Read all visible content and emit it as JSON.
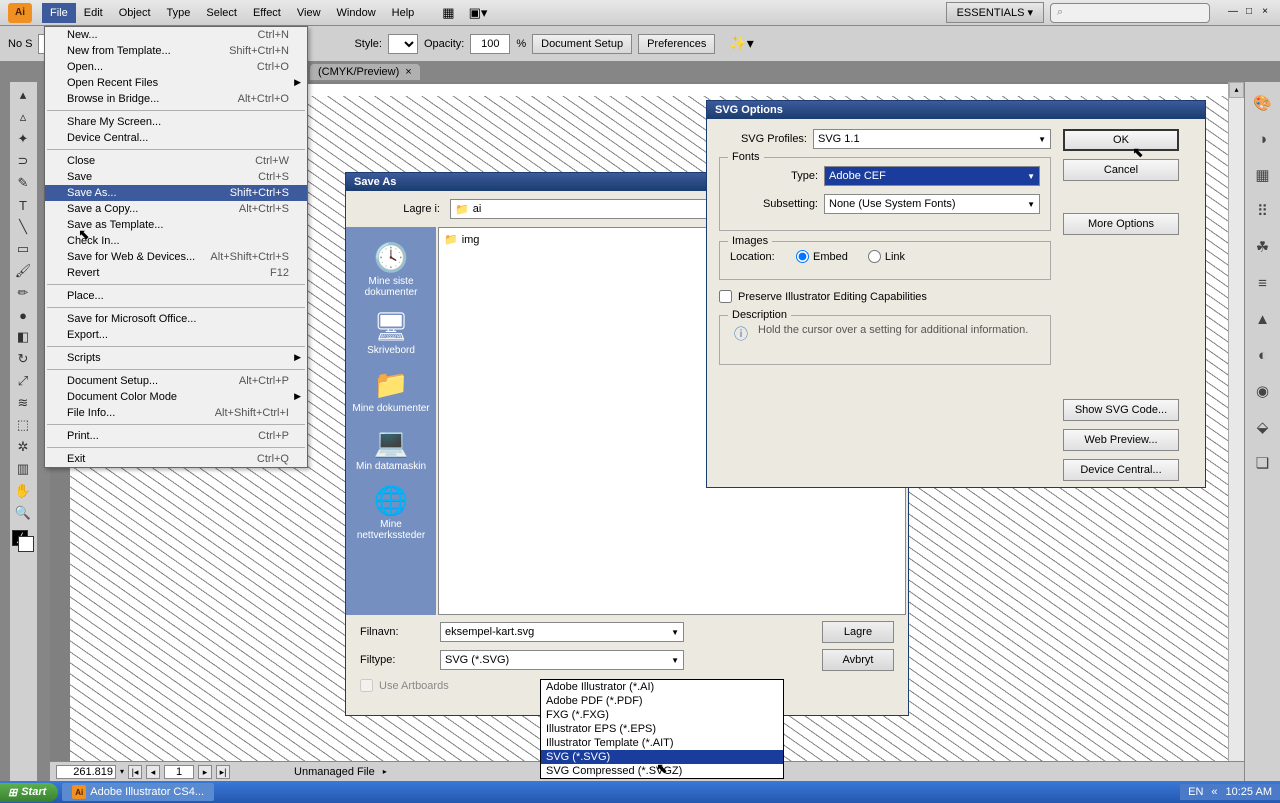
{
  "menubar": {
    "app_icon": "Ai",
    "items": [
      "File",
      "Edit",
      "Object",
      "Type",
      "Select",
      "Effect",
      "View",
      "Window",
      "Help"
    ],
    "essentials": "ESSENTIALS ▾"
  },
  "optbar": {
    "no_selection": "No S",
    "style": "Style:",
    "opacity_label": "Opacity:",
    "opacity_value": "100",
    "opacity_unit": "%",
    "doc_setup": "Document Setup",
    "preferences": "Preferences"
  },
  "doctab": {
    "label": "(CMYK/Preview)",
    "close": "×"
  },
  "file_menu": [
    {
      "label": "New...",
      "shortcut": "Ctrl+N"
    },
    {
      "label": "New from Template...",
      "shortcut": "Shift+Ctrl+N"
    },
    {
      "label": "Open...",
      "shortcut": "Ctrl+O"
    },
    {
      "label": "Open Recent Files",
      "submenu": true
    },
    {
      "label": "Browse in Bridge...",
      "shortcut": "Alt+Ctrl+O"
    },
    {
      "sep": true
    },
    {
      "label": "Share My Screen..."
    },
    {
      "label": "Device Central..."
    },
    {
      "sep": true
    },
    {
      "label": "Close",
      "shortcut": "Ctrl+W"
    },
    {
      "label": "Save",
      "shortcut": "Ctrl+S"
    },
    {
      "label": "Save As...",
      "shortcut": "Shift+Ctrl+S",
      "selected": true
    },
    {
      "label": "Save a Copy...",
      "shortcut": "Alt+Ctrl+S"
    },
    {
      "label": "Save as Template..."
    },
    {
      "label": "Check In..."
    },
    {
      "label": "Save for Web & Devices...",
      "shortcut": "Alt+Shift+Ctrl+S"
    },
    {
      "label": "Revert",
      "shortcut": "F12"
    },
    {
      "sep": true
    },
    {
      "label": "Place..."
    },
    {
      "sep": true
    },
    {
      "label": "Save for Microsoft Office..."
    },
    {
      "label": "Export..."
    },
    {
      "sep": true
    },
    {
      "label": "Scripts",
      "submenu": true
    },
    {
      "sep": true
    },
    {
      "label": "Document Setup...",
      "shortcut": "Alt+Ctrl+P"
    },
    {
      "label": "Document Color Mode",
      "submenu": true
    },
    {
      "label": "File Info...",
      "shortcut": "Alt+Shift+Ctrl+I"
    },
    {
      "sep": true
    },
    {
      "label": "Print...",
      "shortcut": "Ctrl+P"
    },
    {
      "sep": true
    },
    {
      "label": "Exit",
      "shortcut": "Ctrl+Q"
    }
  ],
  "saveas": {
    "title": "Save As",
    "lagre_i": "Lagre i:",
    "folder": "ai",
    "places": [
      {
        "label": "Mine siste dokumenter",
        "ico": "🕓"
      },
      {
        "label": "Skrivebord",
        "ico": "🖥"
      },
      {
        "label": "Mine dokumenter",
        "ico": "📁"
      },
      {
        "label": "Min datamaskin",
        "ico": "💻"
      },
      {
        "label": "Mine nettverkssteder",
        "ico": "🌐"
      }
    ],
    "file_in_list": "img",
    "filnavn_label": "Filnavn:",
    "filnavn_value": "eksempel-kart.svg",
    "filtype_label": "Filtype:",
    "filtype_value": "SVG (*.SVG)",
    "lagre_btn": "Lagre",
    "avbryt_btn": "Avbryt",
    "use_artboards": "Use Artboards"
  },
  "filetype_options": [
    "Adobe Illustrator (*.AI)",
    "Adobe PDF (*.PDF)",
    "FXG (*.FXG)",
    "Illustrator EPS (*.EPS)",
    "Illustrator Template (*.AIT)",
    "SVG (*.SVG)",
    "SVG Compressed (*.SVGZ)"
  ],
  "svg_options": {
    "title": "SVG Options",
    "profiles_label": "SVG Profiles:",
    "profiles_value": "SVG 1.1",
    "fonts_title": "Fonts",
    "type_label": "Type:",
    "type_value": "Adobe CEF",
    "subsetting_label": "Subsetting:",
    "subsetting_value": "None (Use System Fonts)",
    "images_title": "Images",
    "location_label": "Location:",
    "embed": "Embed",
    "link": "Link",
    "preserve": "Preserve Illustrator Editing Capabilities",
    "desc_title": "Description",
    "desc_text": "Hold the cursor over a setting for additional information.",
    "ok": "OK",
    "cancel": "Cancel",
    "more": "More Options",
    "show_code": "Show SVG Code...",
    "web_preview": "Web Preview...",
    "device_central": "Device Central..."
  },
  "status": {
    "zoom": "261.819",
    "page": "1",
    "unmanaged": "Unmanaged File"
  },
  "taskbar": {
    "start": "Start",
    "app": "Adobe Illustrator CS4...",
    "lang": "EN",
    "time": "10:25 AM"
  }
}
